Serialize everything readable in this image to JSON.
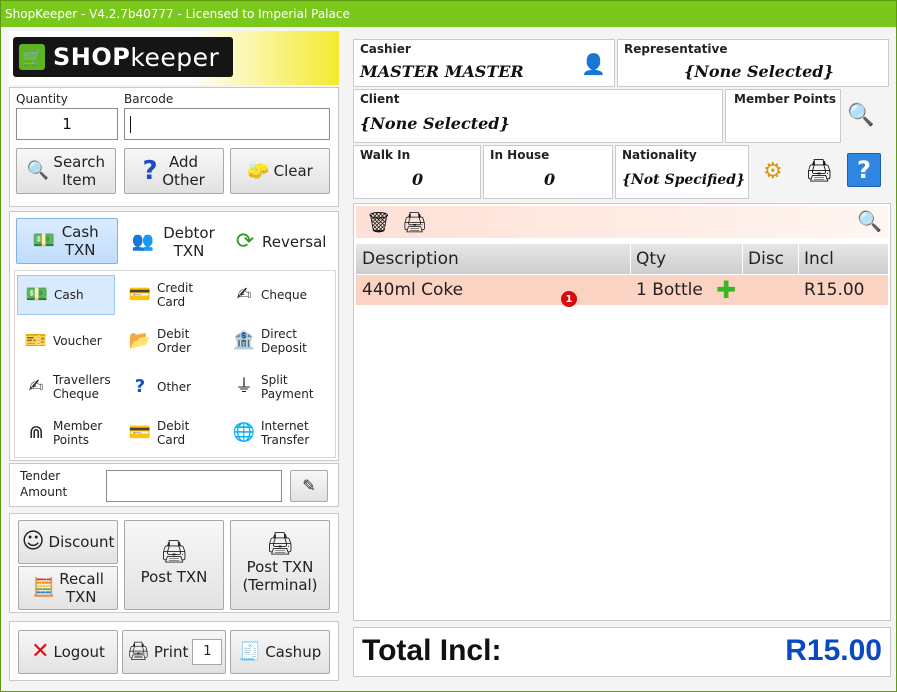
{
  "window": {
    "title": "ShopKeeper - V4.2.7b40777 - Licensed to Imperial Palace"
  },
  "brand": {
    "shop": "SHOP",
    "keeper": "keeper"
  },
  "entry": {
    "quantity_label": "Quantity",
    "quantity_value": "1",
    "barcode_label": "Barcode",
    "barcode_value": ""
  },
  "actions": {
    "search": "Search Item",
    "add_other": "Add Other",
    "clear": "Clear"
  },
  "txn_types": {
    "cash": "Cash TXN",
    "debtor": "Debtor TXN",
    "reversal": "Reversal"
  },
  "payments": [
    {
      "label": "Cash"
    },
    {
      "label": "Credit Card"
    },
    {
      "label": "Cheque"
    },
    {
      "label": "Voucher"
    },
    {
      "label": "Debit Order"
    },
    {
      "label": "Direct Deposit"
    },
    {
      "label": "Travellers Cheque"
    },
    {
      "label": "Other"
    },
    {
      "label": "Split Payment"
    },
    {
      "label": "Member Points"
    },
    {
      "label": "Debit Card"
    },
    {
      "label": "Internet Transfer"
    }
  ],
  "tender": {
    "label": "Tender Amount",
    "value": ""
  },
  "bottom_actions": {
    "discount": "Discount",
    "recall": "Recall TXN",
    "post": "Post TXN",
    "post_terminal": "Post TXN (Terminal)"
  },
  "footer": {
    "logout": "Logout",
    "print": "Print",
    "print_count": "1",
    "cashup": "Cashup"
  },
  "cashier": {
    "label": "Cashier",
    "value": "MASTER MASTER"
  },
  "representative": {
    "label": "Representative",
    "value": "{None Selected}"
  },
  "client": {
    "label": "Client",
    "value": "{None Selected}"
  },
  "member_points": {
    "label": "Member Points",
    "value": ""
  },
  "walk_in": {
    "label": "Walk In",
    "value": "0"
  },
  "in_house": {
    "label": "In House",
    "value": "0"
  },
  "nationality": {
    "label": "Nationality",
    "value": "{Not Specified}"
  },
  "table": {
    "headers": {
      "description": "Description",
      "qty": "Qty",
      "disc": "Disc",
      "incl": "Incl"
    },
    "rows": [
      {
        "description": "440ml Coke",
        "qty": "1 Bottle",
        "disc": "",
        "incl": "R15.00"
      }
    ]
  },
  "badge": "1",
  "total": {
    "label": "Total Incl:",
    "value": "R15.00"
  },
  "colors": {
    "title_bar": "#7bc81d",
    "total_value": "#0a49c2",
    "selected_row": "#fbd3c3"
  }
}
